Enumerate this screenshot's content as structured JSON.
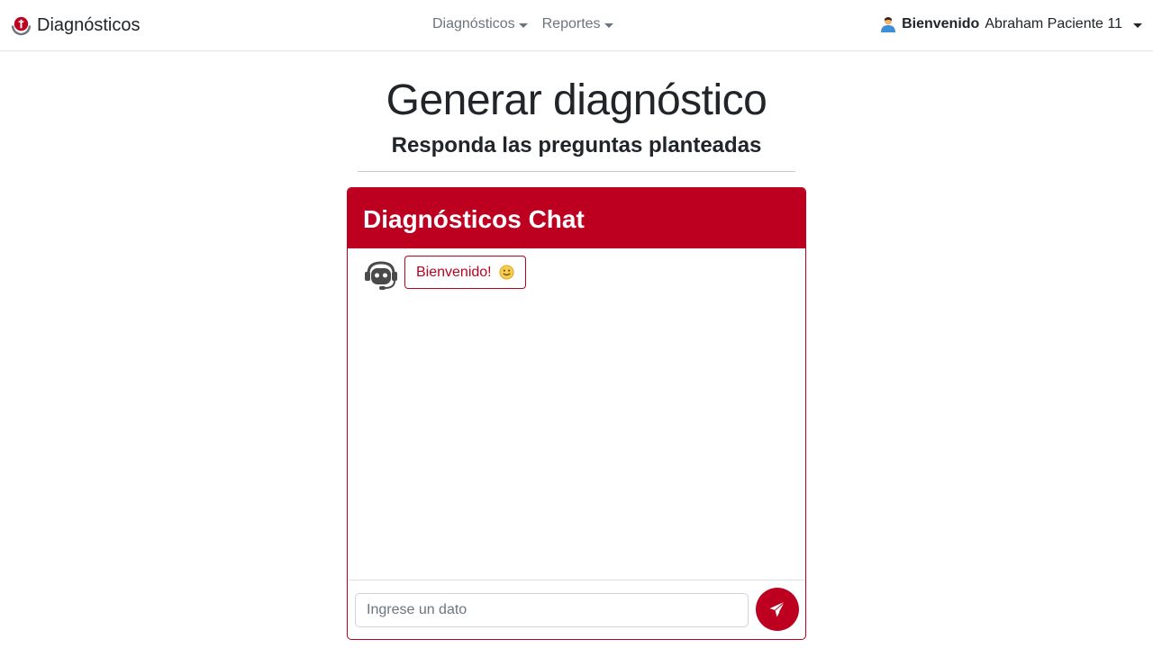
{
  "navbar": {
    "brand": "Diagnósticos",
    "brand_icon": "medical-hands-logo-icon",
    "menus": [
      {
        "label": "Diagnósticos"
      },
      {
        "label": "Reportes"
      }
    ],
    "user": {
      "greeting": "Bienvenido",
      "name": "Abraham Paciente 11",
      "icon": "user-avatar-icon"
    }
  },
  "page": {
    "title": "Generar diagnóstico",
    "subtitle": "Responda las preguntas planteadas"
  },
  "chat": {
    "header": "Diagnósticos Chat",
    "messages": [
      {
        "sender": "bot",
        "text": "Bienvenido!",
        "emoji": "smile-emoji-icon"
      }
    ],
    "input_placeholder": "Ingrese un dato",
    "input_value": "",
    "send_icon": "paper-plane-icon"
  },
  "colors": {
    "accent": "#bd0020",
    "muted": "#6c757d"
  }
}
